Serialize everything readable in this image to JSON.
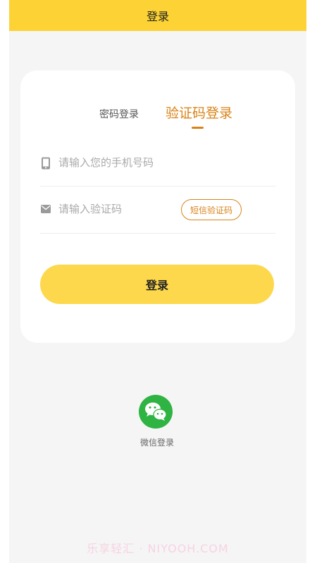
{
  "header": {
    "title": "登录"
  },
  "tabs": {
    "password_label": "密码登录",
    "code_label": "验证码登录",
    "active_color": "#d98317"
  },
  "form": {
    "phone": {
      "placeholder": "请输入您的手机号码",
      "value": "",
      "icon": "phone-icon"
    },
    "code": {
      "placeholder": "请输入验证码",
      "value": "",
      "icon": "mail-icon"
    },
    "sms_button_label": "短信验证码",
    "submit_label": "登录"
  },
  "social": {
    "wechat_label": "微信登录",
    "icon": "wechat-icon"
  },
  "watermark": "乐享轻汇 · NIYOOH.COM",
  "colors": {
    "brand_yellow": "#fcd234",
    "button_yellow": "#fdd84c",
    "wechat_green": "#2fb342"
  }
}
